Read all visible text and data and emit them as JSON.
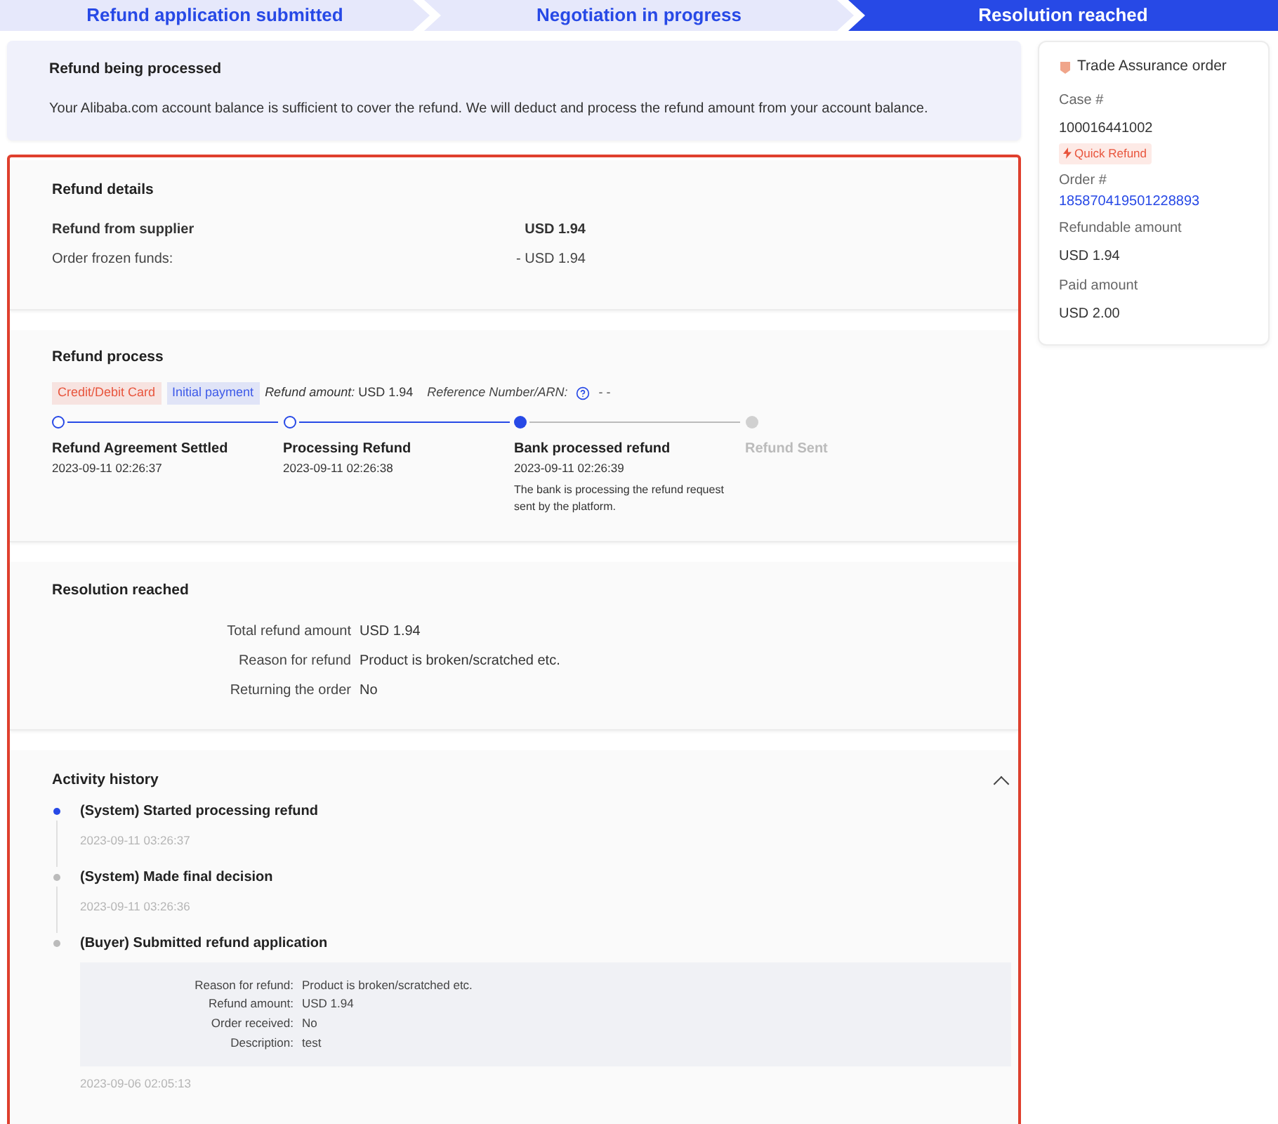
{
  "steps": [
    {
      "label": "Refund application submitted",
      "selected": false
    },
    {
      "label": "Negotiation in progress",
      "selected": false
    },
    {
      "label": "Resolution reached",
      "selected": true
    }
  ],
  "notice": {
    "title": "Refund being processed",
    "text": "Your Alibaba.com account balance is sufficient to cover the refund. We will deduct and process the refund amount from your account balance."
  },
  "refund_details": {
    "title": "Refund details",
    "rows": [
      {
        "label": "Refund from supplier",
        "value": "USD 1.94",
        "bold": true
      },
      {
        "label": "Order frozen funds:",
        "value": "- USD 1.94",
        "bold": false
      }
    ]
  },
  "refund_process": {
    "title": "Refund process",
    "tags": [
      {
        "label": "Credit/Debit Card",
        "color": "#e8553d"
      },
      {
        "label": "Initial payment",
        "color": "#3d5ae8"
      }
    ],
    "amount_label": "Refund amount:",
    "amount": "USD 1.94",
    "reference_label": "Reference Number/ARN:",
    "reference": "- -",
    "stages": [
      {
        "name": "Refund Agreement Settled",
        "time": "2023-09-11 02:26:37",
        "kind": "done"
      },
      {
        "name": "Processing Refund",
        "time": "2023-09-11 02:26:38",
        "kind": "done"
      },
      {
        "name": "Bank processed refund",
        "time": "2023-09-11 02:26:39",
        "note": "The bank is processing the refund request sent by the platform.",
        "kind": "current"
      },
      {
        "name": "Refund Sent",
        "kind": "pending"
      }
    ]
  },
  "resolution": {
    "title": "Resolution reached",
    "rows": [
      {
        "label": "Total refund amount",
        "value": "USD 1.94"
      },
      {
        "label": "Reason for refund",
        "value": "Product is broken/scratched etc."
      },
      {
        "label": "Returning the order",
        "value": "No"
      }
    ]
  },
  "activity": {
    "title": "Activity history",
    "expanded": true,
    "items": [
      {
        "title": "(System) Started processing refund",
        "time": "2023-09-11 03:26:37",
        "active": true
      },
      {
        "title": "(System) Made final decision",
        "time": "2023-09-11 03:26:36",
        "active": false
      },
      {
        "title": "(Buyer) Submitted refund application",
        "time": "2023-09-06 02:05:13",
        "active": false,
        "details": [
          {
            "label": "Reason for refund:",
            "value": "Product is broken/scratched etc."
          },
          {
            "label": "Refund amount:",
            "value": "USD 1.94"
          },
          {
            "label": "Order received:",
            "value": "No"
          },
          {
            "label": "Description:",
            "value": "test"
          }
        ]
      }
    ]
  },
  "order_card": {
    "title": "Trade Assurance order",
    "case_label": "Case #",
    "case_number": "100016441002",
    "badge": "Quick Refund",
    "order_label": "Order #",
    "order_number": "185870419501228893",
    "refundable_label": "Refundable amount",
    "refundable": "USD 1.94",
    "paid_label": "Paid amount",
    "paid": "USD 2.00"
  }
}
